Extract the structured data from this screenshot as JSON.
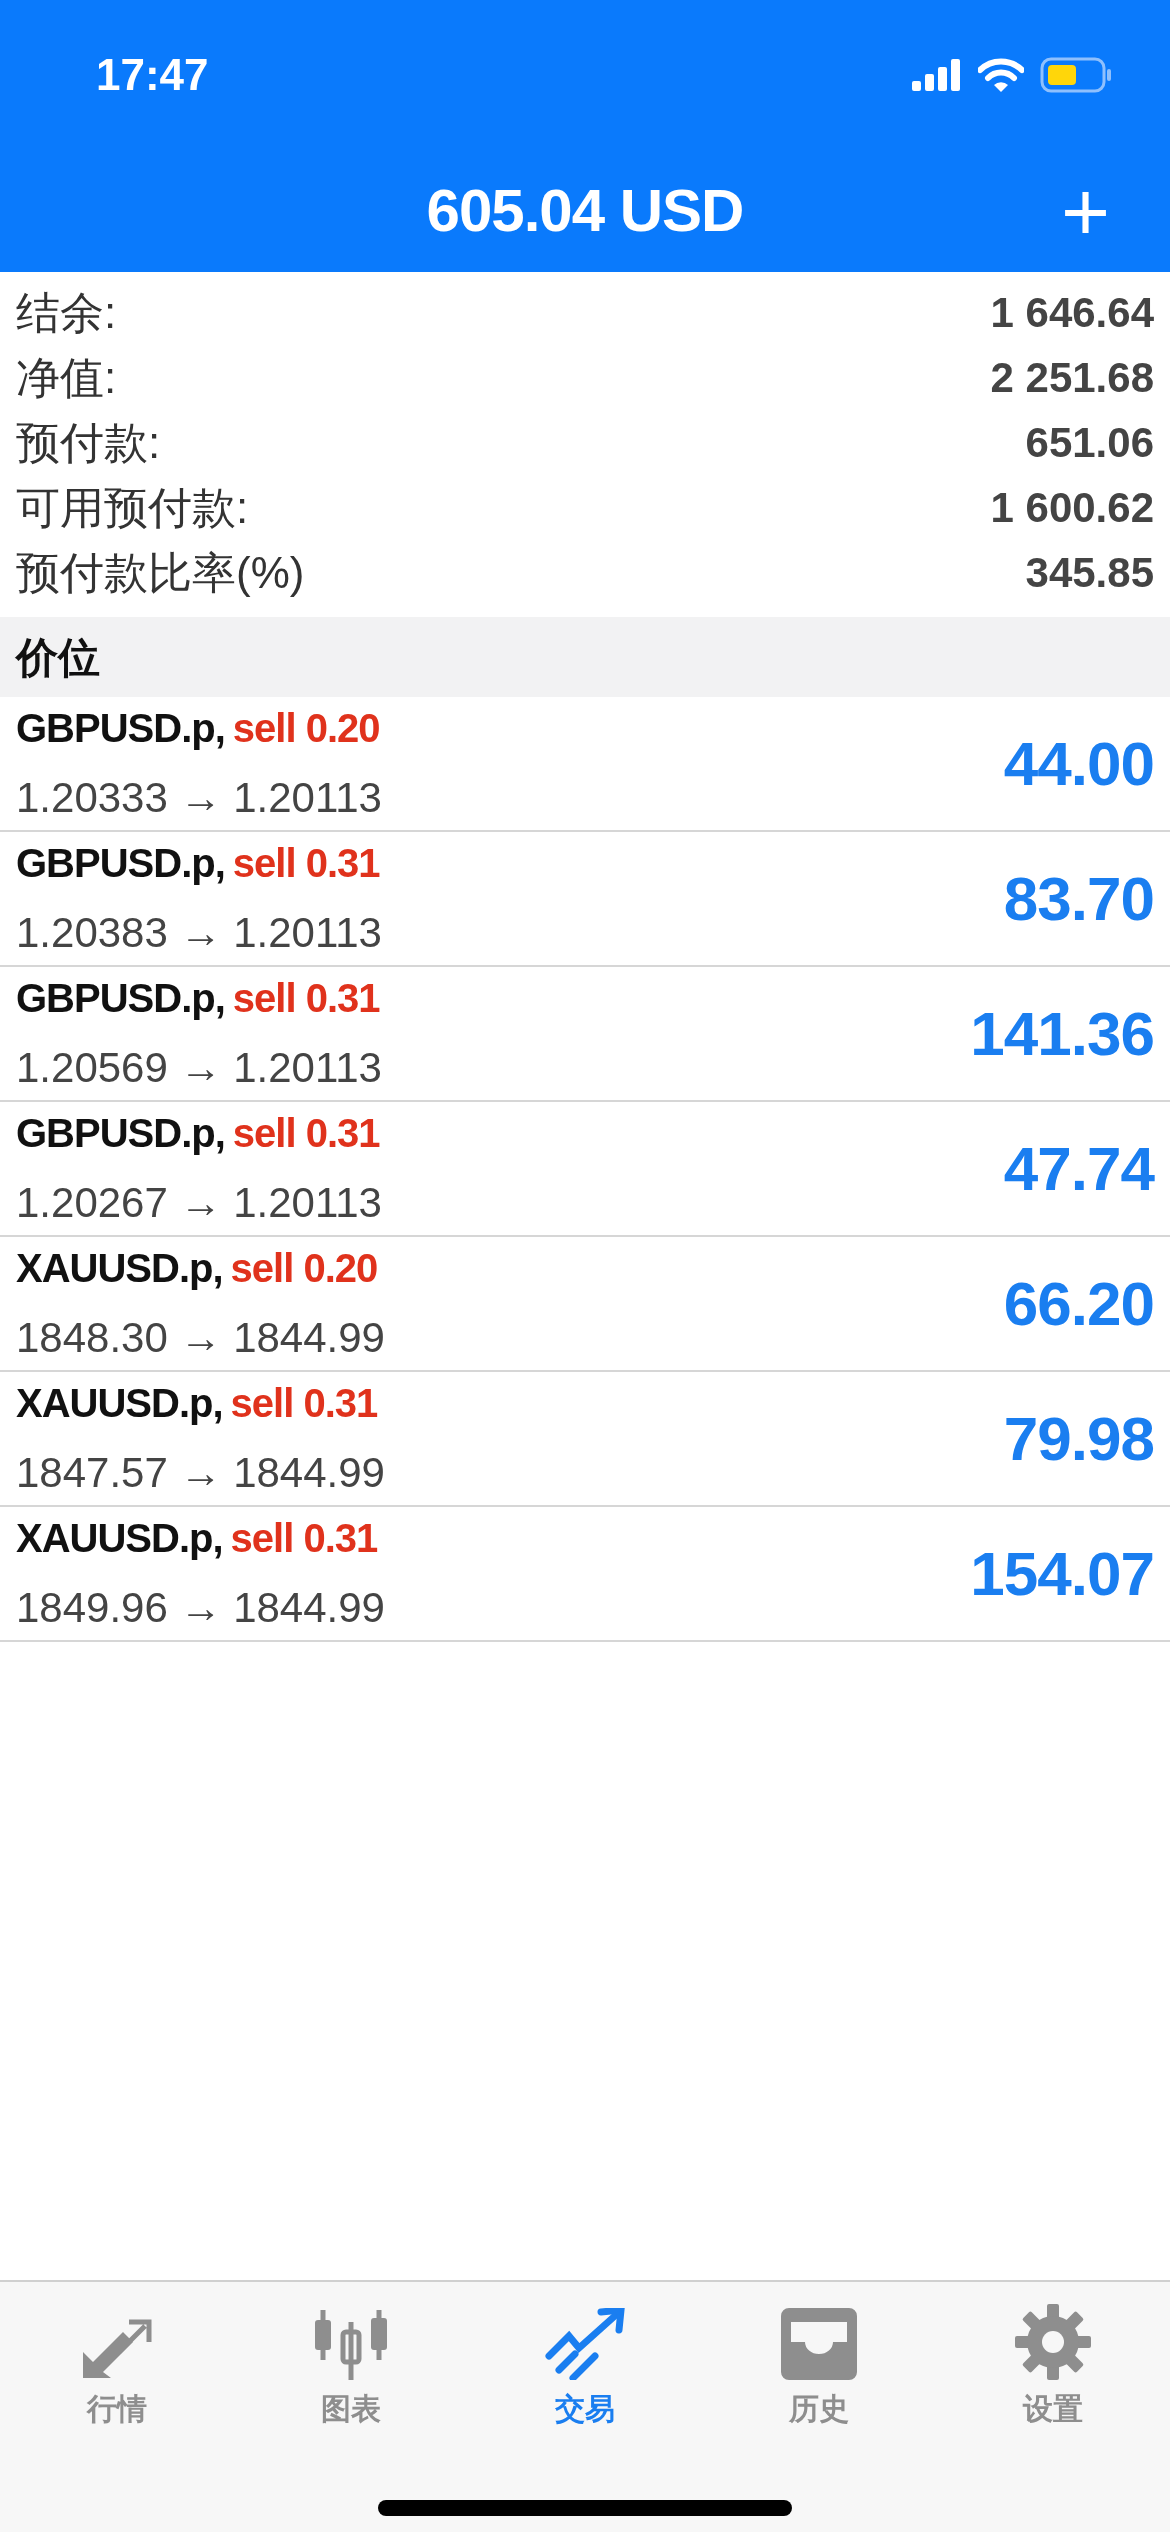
{
  "status_bar": {
    "time": "17:47"
  },
  "header": {
    "title": "605.04 USD",
    "add_button": "+"
  },
  "summary": [
    {
      "label": "结余:",
      "value": "1 646.64"
    },
    {
      "label": "净值:",
      "value": "2 251.68"
    },
    {
      "label": "预付款:",
      "value": "651.06"
    },
    {
      "label": "可用预付款:",
      "value": "1 600.62"
    },
    {
      "label": "预付款比率(%)",
      "value": "345.85"
    }
  ],
  "section": {
    "title": "价位"
  },
  "positions": [
    {
      "symbol": "GBPUSD.p,",
      "order": "sell 0.20",
      "prices": "1.20333 → 1.20113",
      "profit": "44.00"
    },
    {
      "symbol": "GBPUSD.p,",
      "order": "sell 0.31",
      "prices": "1.20383 → 1.20113",
      "profit": "83.70"
    },
    {
      "symbol": "GBPUSD.p,",
      "order": "sell 0.31",
      "prices": "1.20569 → 1.20113",
      "profit": "141.36"
    },
    {
      "symbol": "GBPUSD.p,",
      "order": "sell 0.31",
      "prices": "1.20267 → 1.20113",
      "profit": "47.74"
    },
    {
      "symbol": "XAUUSD.p,",
      "order": "sell 0.20",
      "prices": "1848.30 → 1844.99",
      "profit": "66.20"
    },
    {
      "symbol": "XAUUSD.p,",
      "order": "sell 0.31",
      "prices": "1847.57 → 1844.99",
      "profit": "79.98"
    },
    {
      "symbol": "XAUUSD.p,",
      "order": "sell 0.31",
      "prices": "1849.96 → 1844.99",
      "profit": "154.07"
    }
  ],
  "tabs": [
    {
      "label": "行情",
      "selected": false
    },
    {
      "label": "图表",
      "selected": false
    },
    {
      "label": "交易",
      "selected": true
    },
    {
      "label": "历史",
      "selected": false
    },
    {
      "label": "设置",
      "selected": false
    }
  ]
}
